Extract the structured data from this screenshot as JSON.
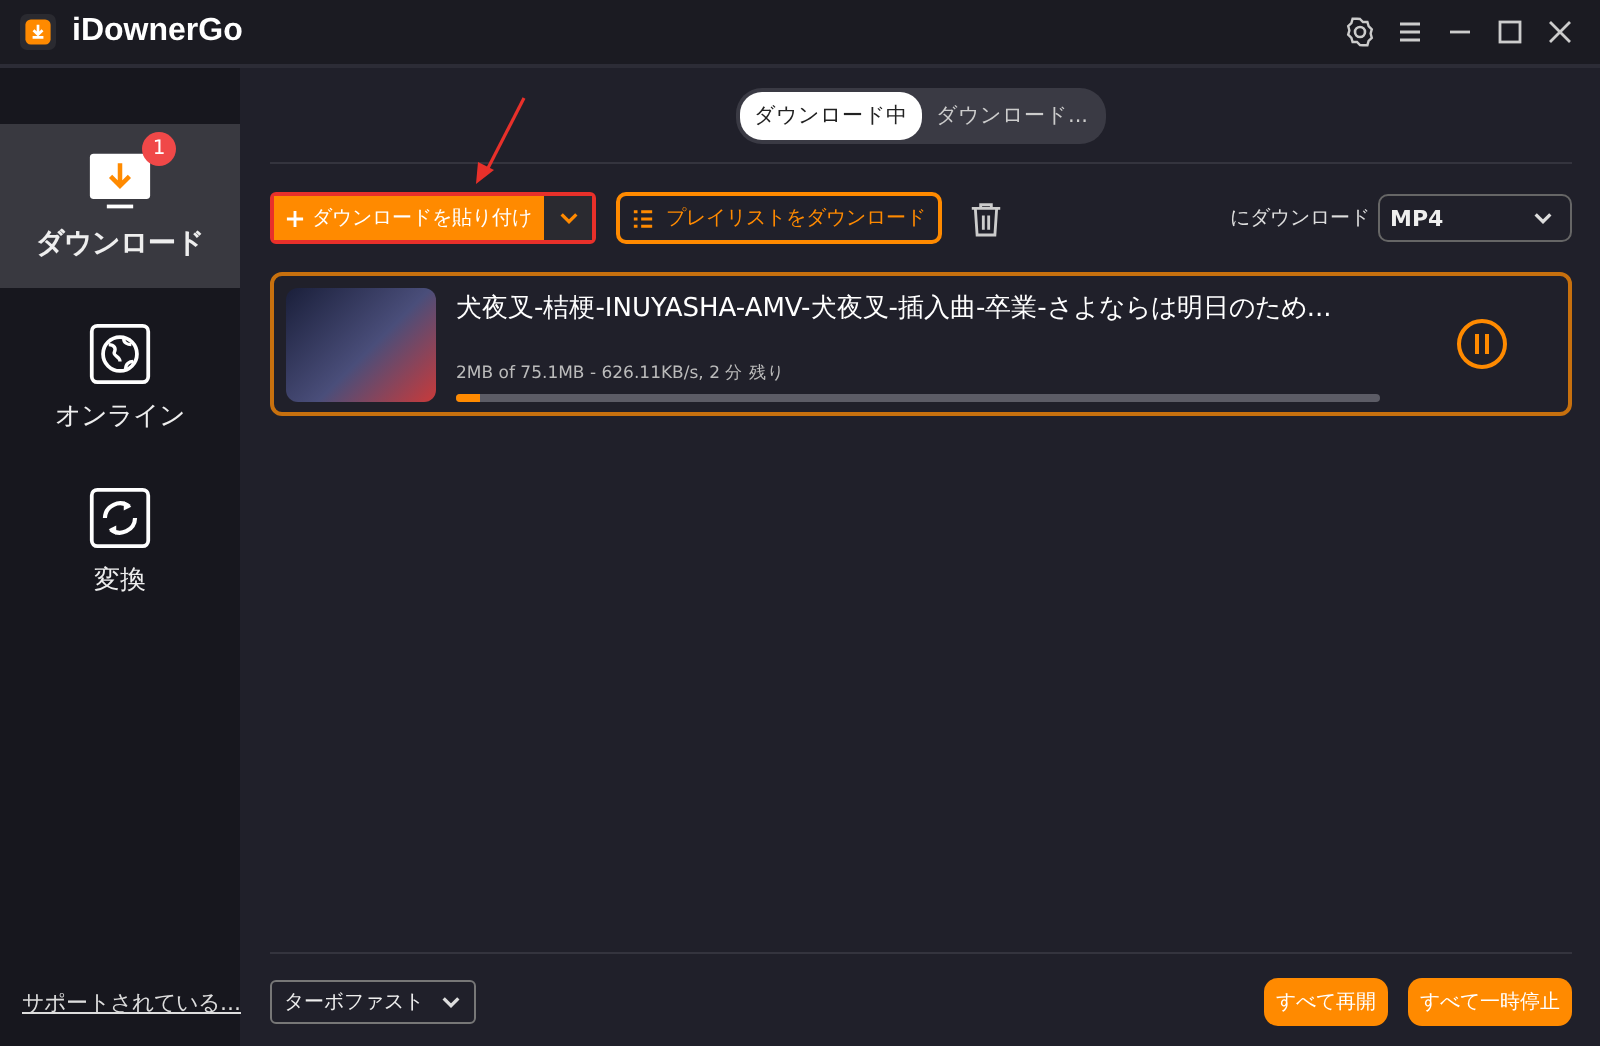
{
  "window": {
    "title": "iDownerGo"
  },
  "sidebar": {
    "items": [
      {
        "kind": "download",
        "label": "ダウンロード",
        "selected": true,
        "badge": "1"
      },
      {
        "kind": "online",
        "label": "オンライン",
        "selected": false
      },
      {
        "kind": "convert",
        "label": "変換",
        "selected": false
      }
    ],
    "support_link": "サポートされている..."
  },
  "tabs": [
    {
      "label": "ダウンロード中",
      "selected": true
    },
    {
      "label": "ダウンロード...",
      "selected": false
    }
  ],
  "toolbar": {
    "paste_button": "ダウンロードを貼り付け",
    "playlist_button": "プレイリストをダウンロード",
    "format_label": "にダウンロード",
    "format_value": "MP4"
  },
  "downloads": [
    {
      "title": "犬夜叉-桔梗-INUYASHA-AMV-犬夜叉-插入曲-卒業-さよならは明日のため...",
      "progress": "2MB of 75.1MB -  626.11KB/s, 2 分 残り",
      "level": 0.025
    }
  ],
  "footer": {
    "speed": "ターボファスト",
    "resume_all": "すべて再開",
    "pause_all": "すべて一時停止"
  }
}
